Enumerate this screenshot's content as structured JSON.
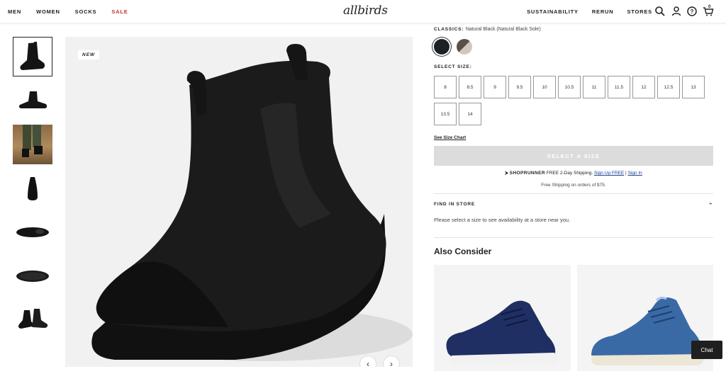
{
  "nav": {
    "left": [
      "MEN",
      "WOMEN",
      "SOCKS",
      "SALE"
    ],
    "logo": "allbirds",
    "right": [
      "SUSTAINABILITY",
      "RERUN",
      "STORES"
    ],
    "cart_count": "0"
  },
  "gallery": {
    "badge": "NEW",
    "thumbnails": [
      "boot-side",
      "boot-pair-side",
      "model-wearing",
      "boot-back",
      "boot-top",
      "boot-sole",
      "boot-pair-angle"
    ]
  },
  "product": {
    "color_label": "CLASSICS:",
    "color_value": "Natural Black (Natural Black Sole)",
    "size_label": "SELECT SIZE:",
    "sizes": [
      "8",
      "8.5",
      "9",
      "9.5",
      "10",
      "10.5",
      "11",
      "11.5",
      "12",
      "12.5",
      "13",
      "13.5",
      "14"
    ],
    "size_chart": "See Size Chart",
    "cta": "SELECT A SIZE",
    "shoprunner_brand": "SHOPRUNNER",
    "shoprunner_text": "FREE 2-Day Shipping.",
    "shoprunner_signup": "Sign Up FREE",
    "shoprunner_sep": "|",
    "shoprunner_signin": "Sign In",
    "free_shipping": "Free Shipping on orders of $75.",
    "find_store_title": "FIND IN STORE",
    "find_store_note": "Please select a size to see availability at a store near you.",
    "also_consider": "Also Consider"
  },
  "chat": "Chat",
  "colors": {
    "sale": "#c43b2b",
    "cta_disabled": "#dcdcdc",
    "link": "#1a3f8f"
  }
}
